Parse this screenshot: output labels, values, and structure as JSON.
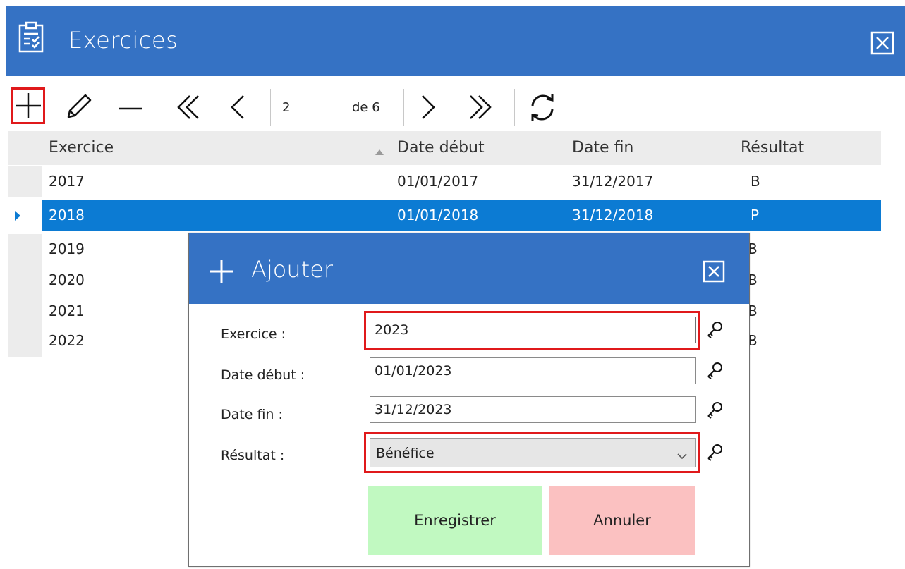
{
  "window": {
    "title": "Exercices",
    "icon": "clipboard-check-icon",
    "accent_color": "#3572c4"
  },
  "toolbar": {
    "add_icon": "plus-icon",
    "edit_icon": "pencil-icon",
    "delete_icon": "minus-icon",
    "first_icon": "double-chevron-left-icon",
    "prev_icon": "chevron-left-icon",
    "page_current": "2",
    "page_total_label": "de 6",
    "next_icon": "chevron-right-icon",
    "last_icon": "double-chevron-right-icon",
    "refresh_icon": "refresh-icon"
  },
  "grid": {
    "columns": [
      "Exercice",
      "Date début",
      "Date fin",
      "Résultat"
    ],
    "sort_indicator": "▲",
    "rows": [
      {
        "exercice": "2017",
        "date_debut": "01/01/2017",
        "date_fin": "31/12/2017",
        "resultat": "B",
        "selected": false
      },
      {
        "exercice": "2018",
        "date_debut": "01/01/2018",
        "date_fin": "31/12/2018",
        "resultat": "P",
        "selected": true
      },
      {
        "exercice": "2019",
        "date_debut": "",
        "date_fin": "",
        "resultat": "B",
        "selected": false
      },
      {
        "exercice": "2020",
        "date_debut": "",
        "date_fin": "",
        "resultat": "B",
        "selected": false
      },
      {
        "exercice": "2021",
        "date_debut": "",
        "date_fin": "",
        "resultat": "B",
        "selected": false
      },
      {
        "exercice": "2022",
        "date_debut": "",
        "date_fin": "",
        "resultat": "B",
        "selected": false
      }
    ],
    "selected_color": "#0c7bd3"
  },
  "dialog": {
    "title": "Ajouter",
    "fields": {
      "exercice": {
        "label": "Exercice :",
        "value": "2023"
      },
      "date_debut": {
        "label": "Date début :",
        "value": "01/01/2023"
      },
      "date_fin": {
        "label": "Date fin :",
        "value": "31/12/2023"
      },
      "resultat": {
        "label": "Résultat :",
        "value": "Bénéfice"
      }
    },
    "save_label": "Enregistrer",
    "cancel_label": "Annuler",
    "save_color": "#c1f9c1",
    "cancel_color": "#fbc1c1",
    "highlight_color": "#e0191b"
  }
}
